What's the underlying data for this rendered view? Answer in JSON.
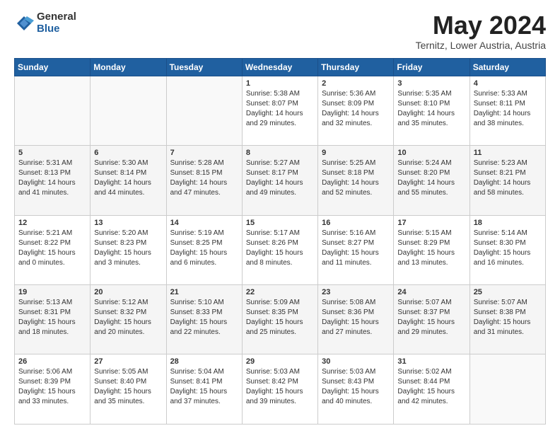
{
  "header": {
    "logo_general": "General",
    "logo_blue": "Blue",
    "title": "May 2024",
    "subtitle": "Ternitz, Lower Austria, Austria"
  },
  "days_of_week": [
    "Sunday",
    "Monday",
    "Tuesday",
    "Wednesday",
    "Thursday",
    "Friday",
    "Saturday"
  ],
  "weeks": [
    [
      {
        "day": "",
        "info": ""
      },
      {
        "day": "",
        "info": ""
      },
      {
        "day": "",
        "info": ""
      },
      {
        "day": "1",
        "info": "Sunrise: 5:38 AM\nSunset: 8:07 PM\nDaylight: 14 hours\nand 29 minutes."
      },
      {
        "day": "2",
        "info": "Sunrise: 5:36 AM\nSunset: 8:09 PM\nDaylight: 14 hours\nand 32 minutes."
      },
      {
        "day": "3",
        "info": "Sunrise: 5:35 AM\nSunset: 8:10 PM\nDaylight: 14 hours\nand 35 minutes."
      },
      {
        "day": "4",
        "info": "Sunrise: 5:33 AM\nSunset: 8:11 PM\nDaylight: 14 hours\nand 38 minutes."
      }
    ],
    [
      {
        "day": "5",
        "info": "Sunrise: 5:31 AM\nSunset: 8:13 PM\nDaylight: 14 hours\nand 41 minutes."
      },
      {
        "day": "6",
        "info": "Sunrise: 5:30 AM\nSunset: 8:14 PM\nDaylight: 14 hours\nand 44 minutes."
      },
      {
        "day": "7",
        "info": "Sunrise: 5:28 AM\nSunset: 8:15 PM\nDaylight: 14 hours\nand 47 minutes."
      },
      {
        "day": "8",
        "info": "Sunrise: 5:27 AM\nSunset: 8:17 PM\nDaylight: 14 hours\nand 49 minutes."
      },
      {
        "day": "9",
        "info": "Sunrise: 5:25 AM\nSunset: 8:18 PM\nDaylight: 14 hours\nand 52 minutes."
      },
      {
        "day": "10",
        "info": "Sunrise: 5:24 AM\nSunset: 8:20 PM\nDaylight: 14 hours\nand 55 minutes."
      },
      {
        "day": "11",
        "info": "Sunrise: 5:23 AM\nSunset: 8:21 PM\nDaylight: 14 hours\nand 58 minutes."
      }
    ],
    [
      {
        "day": "12",
        "info": "Sunrise: 5:21 AM\nSunset: 8:22 PM\nDaylight: 15 hours\nand 0 minutes."
      },
      {
        "day": "13",
        "info": "Sunrise: 5:20 AM\nSunset: 8:23 PM\nDaylight: 15 hours\nand 3 minutes."
      },
      {
        "day": "14",
        "info": "Sunrise: 5:19 AM\nSunset: 8:25 PM\nDaylight: 15 hours\nand 6 minutes."
      },
      {
        "day": "15",
        "info": "Sunrise: 5:17 AM\nSunset: 8:26 PM\nDaylight: 15 hours\nand 8 minutes."
      },
      {
        "day": "16",
        "info": "Sunrise: 5:16 AM\nSunset: 8:27 PM\nDaylight: 15 hours\nand 11 minutes."
      },
      {
        "day": "17",
        "info": "Sunrise: 5:15 AM\nSunset: 8:29 PM\nDaylight: 15 hours\nand 13 minutes."
      },
      {
        "day": "18",
        "info": "Sunrise: 5:14 AM\nSunset: 8:30 PM\nDaylight: 15 hours\nand 16 minutes."
      }
    ],
    [
      {
        "day": "19",
        "info": "Sunrise: 5:13 AM\nSunset: 8:31 PM\nDaylight: 15 hours\nand 18 minutes."
      },
      {
        "day": "20",
        "info": "Sunrise: 5:12 AM\nSunset: 8:32 PM\nDaylight: 15 hours\nand 20 minutes."
      },
      {
        "day": "21",
        "info": "Sunrise: 5:10 AM\nSunset: 8:33 PM\nDaylight: 15 hours\nand 22 minutes."
      },
      {
        "day": "22",
        "info": "Sunrise: 5:09 AM\nSunset: 8:35 PM\nDaylight: 15 hours\nand 25 minutes."
      },
      {
        "day": "23",
        "info": "Sunrise: 5:08 AM\nSunset: 8:36 PM\nDaylight: 15 hours\nand 27 minutes."
      },
      {
        "day": "24",
        "info": "Sunrise: 5:07 AM\nSunset: 8:37 PM\nDaylight: 15 hours\nand 29 minutes."
      },
      {
        "day": "25",
        "info": "Sunrise: 5:07 AM\nSunset: 8:38 PM\nDaylight: 15 hours\nand 31 minutes."
      }
    ],
    [
      {
        "day": "26",
        "info": "Sunrise: 5:06 AM\nSunset: 8:39 PM\nDaylight: 15 hours\nand 33 minutes."
      },
      {
        "day": "27",
        "info": "Sunrise: 5:05 AM\nSunset: 8:40 PM\nDaylight: 15 hours\nand 35 minutes."
      },
      {
        "day": "28",
        "info": "Sunrise: 5:04 AM\nSunset: 8:41 PM\nDaylight: 15 hours\nand 37 minutes."
      },
      {
        "day": "29",
        "info": "Sunrise: 5:03 AM\nSunset: 8:42 PM\nDaylight: 15 hours\nand 39 minutes."
      },
      {
        "day": "30",
        "info": "Sunrise: 5:03 AM\nSunset: 8:43 PM\nDaylight: 15 hours\nand 40 minutes."
      },
      {
        "day": "31",
        "info": "Sunrise: 5:02 AM\nSunset: 8:44 PM\nDaylight: 15 hours\nand 42 minutes."
      },
      {
        "day": "",
        "info": ""
      }
    ]
  ]
}
